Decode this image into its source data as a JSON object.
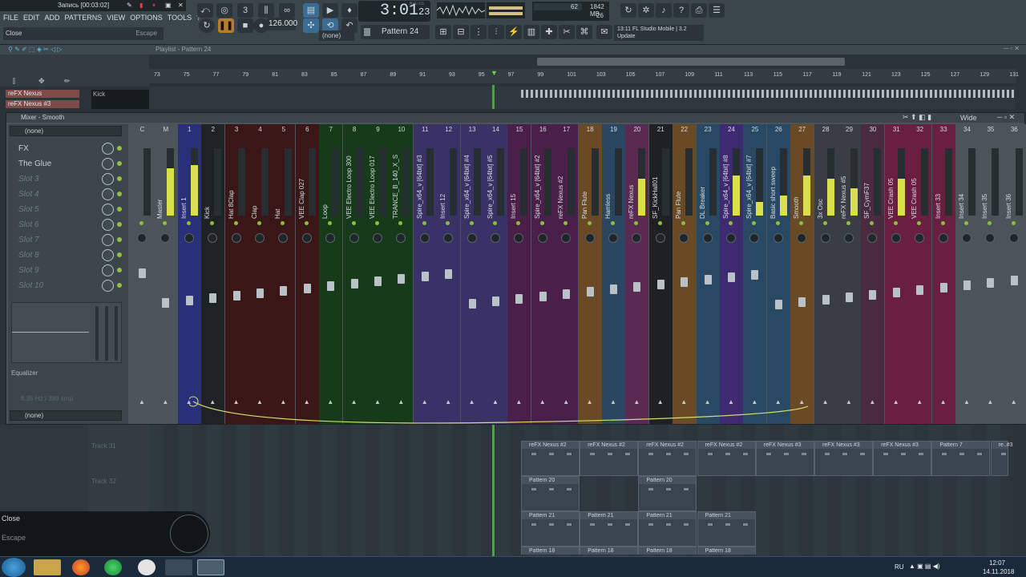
{
  "recorder": {
    "title": "Запись [00:03:02]"
  },
  "menu": [
    "FILE",
    "EDIT",
    "ADD",
    "PATTERNS",
    "VIEW",
    "OPTIONS",
    "TOOLS",
    "?"
  ],
  "hint": {
    "text": "Close",
    "shortcut": "Escape"
  },
  "transport": {
    "time": "3:01",
    "time_small": "23",
    "mcs": "M:S:CS",
    "tempo": "126.000",
    "pattern": "Pattern 24",
    "snap": "(none)"
  },
  "cpu": {
    "cpu_val": "62",
    "ram": "1842 MB",
    "voices": "26"
  },
  "news": {
    "line1": "13:11  FL Studio Mobile | 3.2",
    "line2": "Update"
  },
  "playlist": {
    "title": "Playlist - Pattern 24",
    "tracks": [
      "reFX Nexus",
      "reFX Nexus #3",
      "Kick"
    ],
    "track_labels": [
      "Track 31",
      "Track 32"
    ],
    "ruler": [
      "73",
      "75",
      "77",
      "79",
      "81",
      "83",
      "85",
      "87",
      "89",
      "91",
      "93",
      "95",
      "97",
      "99",
      "101",
      "103",
      "105",
      "107",
      "109",
      "111",
      "113",
      "115",
      "117",
      "119",
      "121",
      "123",
      "125",
      "127",
      "129",
      "131"
    ]
  },
  "mixer": {
    "title": "Mixer - Smooth",
    "view": "Wide",
    "preset": "(none)",
    "fx_label": "FX",
    "glue": "The Glue",
    "slots": [
      "Slot 3",
      "Slot 4",
      "Slot 5",
      "Slot 6",
      "Slot 7",
      "Slot 8",
      "Slot 9",
      "Slot 10"
    ],
    "equalizer": "Equalizer",
    "bottom_preset": "(none)",
    "note": "8.35 Hz / 389 smp",
    "strips": [
      {
        "num": "C",
        "name": "",
        "color": "#4a5459",
        "level": 0.0
      },
      {
        "num": "M",
        "name": "Master",
        "color": "#4a5459",
        "level": 0.7
      },
      {
        "num": "1",
        "name": "Insert 1",
        "color": "#2a2f7a",
        "level": 0.75
      },
      {
        "num": "2",
        "name": "Kick",
        "color": "#1f2224",
        "level": 0
      },
      {
        "num": "3",
        "name": "Hat 8Clap",
        "color": "#3a1616",
        "level": 0
      },
      {
        "num": "4",
        "name": "Clap",
        "color": "#3a1616",
        "level": 0
      },
      {
        "num": "5",
        "name": "Hat",
        "color": "#3a1616",
        "level": 0
      },
      {
        "num": "6",
        "name": "VEE Clap 027",
        "color": "#3a1616",
        "level": 0
      },
      {
        "num": "7",
        "name": "Loop",
        "color": "#173a1a",
        "level": 0
      },
      {
        "num": "8",
        "name": "VEE Electro Loop 300",
        "color": "#173a1a",
        "level": 0
      },
      {
        "num": "9",
        "name": "VEE Electro Loop 017",
        "color": "#173a1a",
        "level": 0
      },
      {
        "num": "10",
        "name": "TRANCE_B_140_X_S11",
        "color": "#173a1a",
        "level": 0
      },
      {
        "num": "11",
        "name": "Spire_x64_v [64bit] #3",
        "color": "#3a3266",
        "level": 0
      },
      {
        "num": "12",
        "name": "Insert 12",
        "color": "#3a3266",
        "level": 0
      },
      {
        "num": "13",
        "name": "Spire_x64_v [64bit] #4",
        "color": "#3a3266",
        "level": 0
      },
      {
        "num": "14",
        "name": "Spire_x64_v [64bit] #5",
        "color": "#3a3266",
        "level": 0
      },
      {
        "num": "15",
        "name": "Insert 15",
        "color": "#4a1f4a",
        "level": 0
      },
      {
        "num": "16",
        "name": "Spire_x64_v [64bit] #2",
        "color": "#4a1f4a",
        "level": 0
      },
      {
        "num": "17",
        "name": "reFX Nexus #2",
        "color": "#4a1f4a",
        "level": 0
      },
      {
        "num": "18",
        "name": "Pan Flute",
        "color": "#6a4a24",
        "level": 0
      },
      {
        "num": "19",
        "name": "Hamless",
        "color": "#2a4660",
        "level": 0
      },
      {
        "num": "20",
        "name": "reFX Nexus",
        "color": "#5a2a52",
        "level": 0.55
      },
      {
        "num": "21",
        "name": "SF_KickHall01",
        "color": "#1e2022",
        "level": 0
      },
      {
        "num": "22",
        "name": "Pan Flute",
        "color": "#6a4a24",
        "level": 0
      },
      {
        "num": "23",
        "name": "DL Breaker",
        "color": "#284864",
        "level": 0
      },
      {
        "num": "24",
        "name": "Spire_x64_v [64bit] #8",
        "color": "#3e2a70",
        "level": 0.6
      },
      {
        "num": "25",
        "name": "Spire_x64_v [64bit] #7",
        "color": "#284864",
        "level": 0.2
      },
      {
        "num": "26",
        "name": "Basic short sweep",
        "color": "#284864",
        "level": 0.3
      },
      {
        "num": "27",
        "name": "Smooth",
        "color": "#6a4a24",
        "level": 0.6
      },
      {
        "num": "28",
        "name": "3x Osc",
        "color": "#3a3e44",
        "level": 0.55
      },
      {
        "num": "29",
        "name": "reFX Nexus #5",
        "color": "#3a3e44",
        "level": 0.4
      },
      {
        "num": "30",
        "name": "SF_CymF37",
        "color": "#4a2a40",
        "level": 0
      },
      {
        "num": "31",
        "name": "VEE Crash 05",
        "color": "#6a1f40",
        "level": 0.55
      },
      {
        "num": "32",
        "name": "VEE Crash 05",
        "color": "#6a1f40",
        "level": 0
      },
      {
        "num": "33",
        "name": "Insert 33",
        "color": "#6a1f40",
        "level": 0
      },
      {
        "num": "34",
        "name": "Insert 34",
        "color": "#4a5459",
        "level": 0
      },
      {
        "num": "35",
        "name": "Insert 35",
        "color": "#4a5459",
        "level": 0
      },
      {
        "num": "36",
        "name": "Insert 36",
        "color": "#4a5459",
        "level": 0
      }
    ]
  },
  "clips": [
    {
      "label": "reFX Nexus #2",
      "row": 0,
      "col": 0
    },
    {
      "label": "reFX Nexus #2",
      "row": 0,
      "col": 1
    },
    {
      "label": "reFX Nexus #2",
      "row": 0,
      "col": 2
    },
    {
      "label": "reFX Nexus #2",
      "row": 0,
      "col": 3
    },
    {
      "label": "reFX Nexus #3",
      "row": 0,
      "col": 4
    },
    {
      "label": "reFX Nexus #3",
      "row": 0,
      "col": 5
    },
    {
      "label": "reFX Nexus #3",
      "row": 0,
      "col": 6
    },
    {
      "label": "Pattern 7",
      "row": 0,
      "col": 7
    },
    {
      "label": "re..#3",
      "row": 0,
      "col": 8
    },
    {
      "label": "Pattern 20",
      "row": 1,
      "col": 0
    },
    {
      "label": "Pattern 20",
      "row": 1,
      "col": 2
    },
    {
      "label": "Pattern 21",
      "row": 2,
      "col": 0
    },
    {
      "label": "Pattern 21",
      "row": 2,
      "col": 1
    },
    {
      "label": "Pattern 21",
      "row": 2,
      "col": 2
    },
    {
      "label": "Pattern 21",
      "row": 2,
      "col": 3
    },
    {
      "label": "Pattern 18",
      "row": 3,
      "col": 0
    },
    {
      "label": "Pattern 18",
      "row": 3,
      "col": 1
    },
    {
      "label": "Pattern 18",
      "row": 3,
      "col": 2
    },
    {
      "label": "Pattern 18",
      "row": 3,
      "col": 3
    }
  ],
  "overlay": {
    "close": "Close",
    "escape": "Escape"
  },
  "taskbar": {
    "lang": "RU",
    "time": "12:07",
    "date": "14.11.2018"
  }
}
